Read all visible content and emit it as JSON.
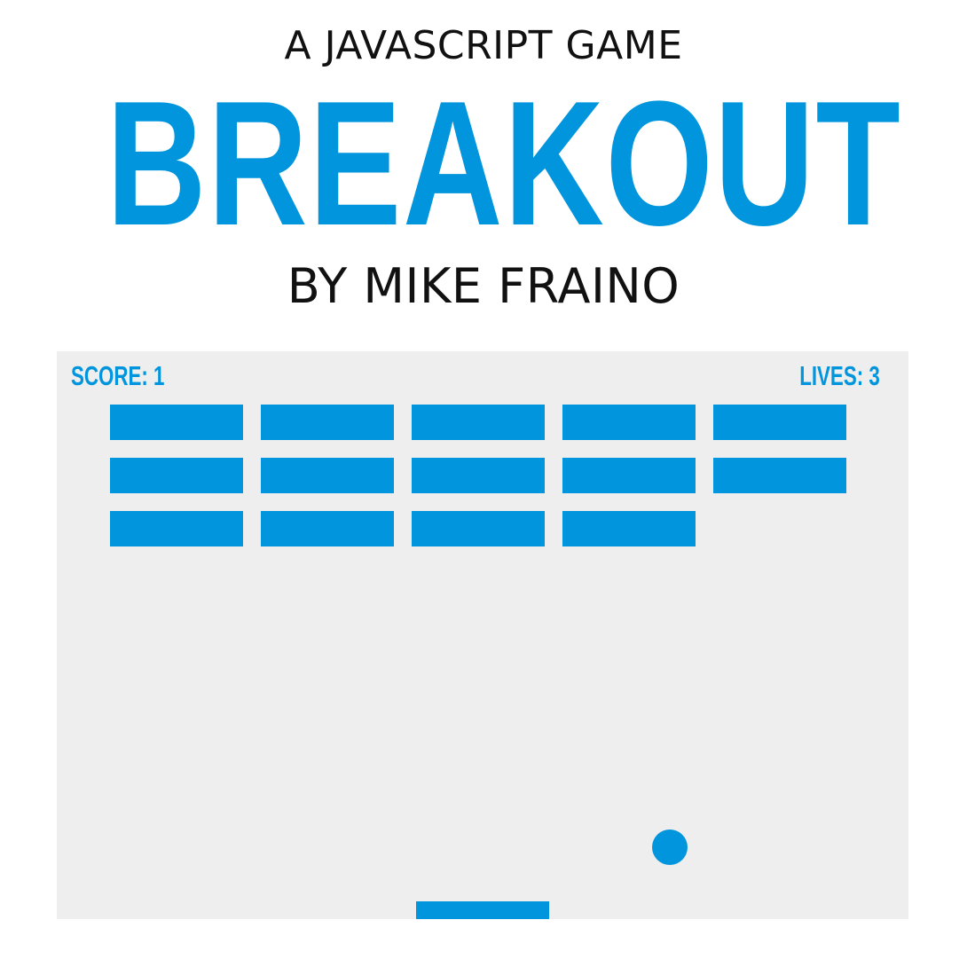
{
  "header": {
    "subtitle": "A JAVASCRIPT GAME",
    "title": "BREAKOUT",
    "byline": "BY MIKE FRAINO"
  },
  "game": {
    "score_label": "SCORE: 1",
    "lives_label": "LIVES: 3",
    "score": 1,
    "lives": 3,
    "brick_rows": [
      [
        true,
        true,
        true,
        true,
        true
      ],
      [
        true,
        true,
        true,
        true,
        true
      ],
      [
        true,
        true,
        true,
        true,
        false
      ]
    ],
    "colors": {
      "accent": "#0095dd",
      "canvas_bg": "#eeeeee",
      "text": "#111111",
      "page_bg": "#ffffff"
    }
  }
}
